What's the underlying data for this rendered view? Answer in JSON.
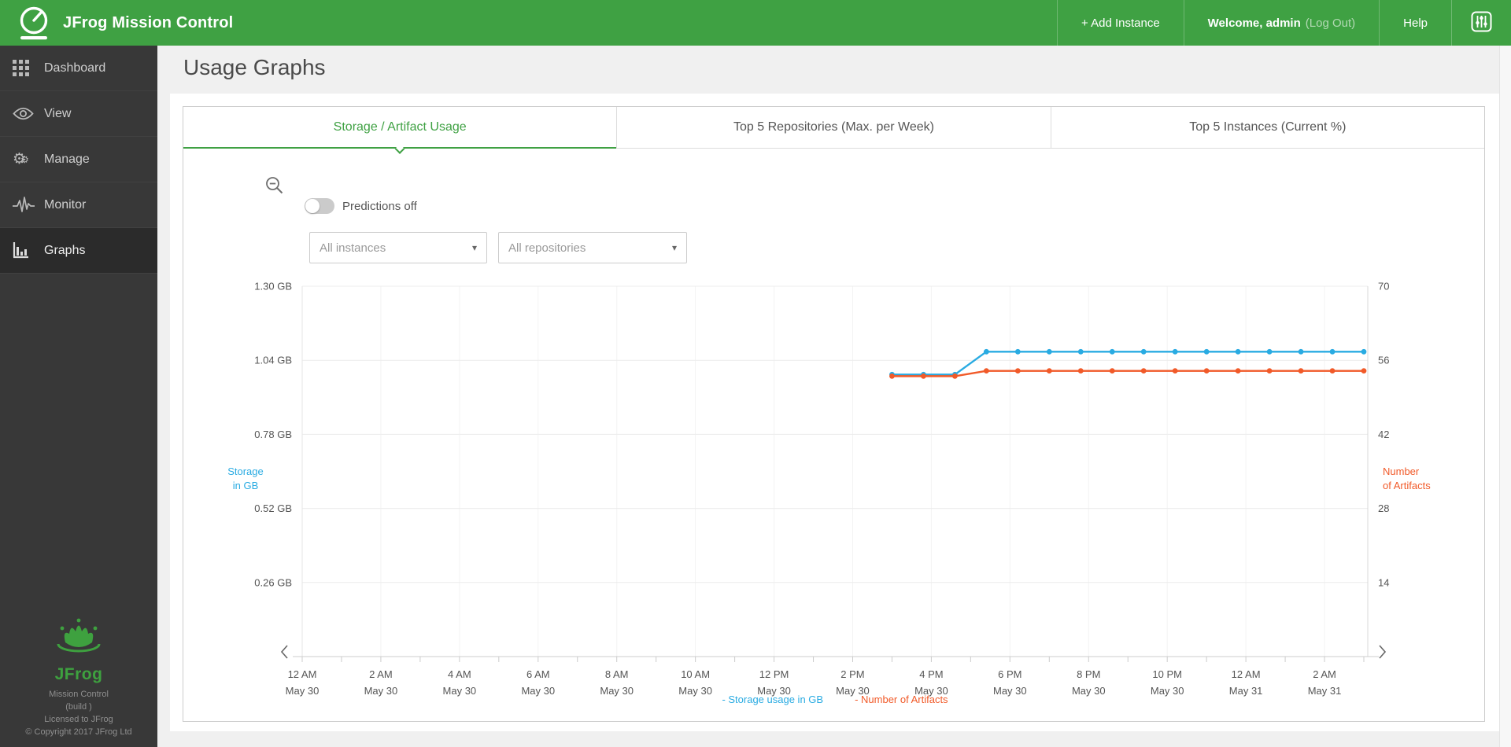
{
  "header": {
    "app_title": "JFrog Mission Control",
    "add_instance_label": "+ Add Instance",
    "welcome_label": "Welcome, admin",
    "logout_label": "(Log Out)",
    "help_label": "Help"
  },
  "icons": {
    "logo": "gauge-icon",
    "top_right": "sliders-icon",
    "sidebar": [
      "grid-icon",
      "eye-icon",
      "gears-icon",
      "pulse-icon",
      "bar-chart-icon"
    ],
    "chart": [
      "zoom-out-icon",
      "chevron-left-icon",
      "chevron-right-icon"
    ]
  },
  "colors": {
    "brand_green": "#3fa143",
    "storage_blue": "#29abe2",
    "artifacts_orange": "#f15a29"
  },
  "sidebar": {
    "items": [
      {
        "label": "Dashboard",
        "selected": false
      },
      {
        "label": "View",
        "selected": false
      },
      {
        "label": "Manage",
        "selected": false
      },
      {
        "label": "Monitor",
        "selected": false
      },
      {
        "label": "Graphs",
        "selected": true
      }
    ],
    "footer": {
      "brand": "JFrog",
      "lines": [
        "Mission Control",
        "(build )",
        "Licensed to JFrog",
        "© Copyright 2017 JFrog Ltd"
      ]
    }
  },
  "page": {
    "title": "Usage Graphs"
  },
  "tabs": [
    {
      "label": "Storage / Artifact Usage",
      "active": true
    },
    {
      "label": "Top 5 Repositories (Max. per Week)",
      "active": false
    },
    {
      "label": "Top 5 Instances (Current %)",
      "active": false
    }
  ],
  "controls": {
    "predictions_label": "Predictions off",
    "predictions_on": false,
    "instances_placeholder": "All instances",
    "repositories_placeholder": "All repositories"
  },
  "chart_data": {
    "type": "line",
    "x_axis": {
      "end_hour": 27.1,
      "tick_interval_hours": 2,
      "minor_tick_hours": 1,
      "labels": [
        {
          "hour": 0,
          "time": "12 AM",
          "date": "May 30"
        },
        {
          "hour": 2,
          "time": "2 AM",
          "date": "May 30"
        },
        {
          "hour": 4,
          "time": "4 AM",
          "date": "May 30"
        },
        {
          "hour": 6,
          "time": "6 AM",
          "date": "May 30"
        },
        {
          "hour": 8,
          "time": "8 AM",
          "date": "May 30"
        },
        {
          "hour": 10,
          "time": "10 AM",
          "date": "May 30"
        },
        {
          "hour": 12,
          "time": "12 PM",
          "date": "May 30"
        },
        {
          "hour": 14,
          "time": "2 PM",
          "date": "May 30"
        },
        {
          "hour": 16,
          "time": "4 PM",
          "date": "May 30"
        },
        {
          "hour": 18,
          "time": "6 PM",
          "date": "May 30"
        },
        {
          "hour": 20,
          "time": "8 PM",
          "date": "May 30"
        },
        {
          "hour": 22,
          "time": "10 PM",
          "date": "May 30"
        },
        {
          "hour": 24,
          "time": "12 AM",
          "date": "May 31"
        },
        {
          "hour": 26,
          "time": "2 AM",
          "date": "May 31"
        }
      ]
    },
    "y_left": {
      "label": "Storage\nin GB",
      "label_lines": [
        "Storage",
        "in GB"
      ],
      "max": 1.3,
      "min": 0,
      "color": "#29abe2",
      "ticks": [
        {
          "value": 1.3,
          "label": "1.30 GB"
        },
        {
          "value": 1.04,
          "label": "1.04 GB"
        },
        {
          "value": 0.78,
          "label": "0.78 GB"
        },
        {
          "value": 0.52,
          "label": "0.52 GB"
        },
        {
          "value": 0.26,
          "label": "0.26 GB"
        }
      ]
    },
    "y_right": {
      "label": "Number\nof Artifacts",
      "label_lines": [
        "Number",
        "of Artifacts"
      ],
      "max": 70,
      "min": 0,
      "color": "#f15a29",
      "ticks": [
        {
          "value": 70,
          "label": "70"
        },
        {
          "value": 56,
          "label": "56"
        },
        {
          "value": 42,
          "label": "42"
        },
        {
          "value": 28,
          "label": "28"
        },
        {
          "value": 14,
          "label": "14"
        }
      ]
    },
    "series": [
      {
        "name": "Storage usage in GB",
        "axis": "left",
        "color": "#29abe2",
        "x_hours": [
          15,
          15.8,
          16.6,
          17.4,
          18.2,
          19,
          19.8,
          20.6,
          21.4,
          22.2,
          23,
          23.8,
          24.6,
          25.4,
          26.2,
          27
        ],
        "values": [
          0.99,
          0.99,
          0.99,
          1.07,
          1.07,
          1.07,
          1.07,
          1.07,
          1.07,
          1.07,
          1.07,
          1.07,
          1.07,
          1.07,
          1.07,
          1.07
        ]
      },
      {
        "name": "Number of Artifacts",
        "axis": "right",
        "color": "#f15a29",
        "x_hours": [
          15,
          15.8,
          16.6,
          17.4,
          18.2,
          19,
          19.8,
          20.6,
          21.4,
          22.2,
          23,
          23.8,
          24.6,
          25.4,
          26.2,
          27
        ],
        "values": [
          53,
          53,
          53,
          54,
          54,
          54,
          54,
          54,
          54,
          54,
          54,
          54,
          54,
          54,
          54,
          54
        ]
      }
    ],
    "legend": [
      {
        "label": "- Storage usage in GB",
        "color": "#29abe2"
      },
      {
        "label": "- Number of Artifacts",
        "color": "#f15a29"
      }
    ],
    "grid": true,
    "legend_position": "bottom-center"
  }
}
